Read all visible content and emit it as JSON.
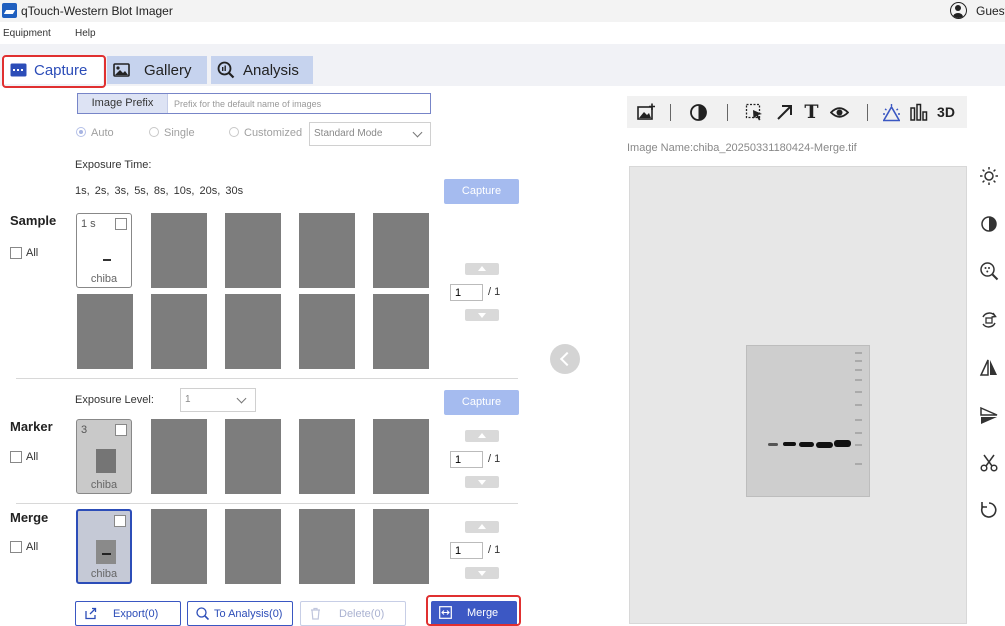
{
  "window": {
    "title": "qTouch-Western Blot Imager",
    "user": "Guest"
  },
  "menu": {
    "items": [
      "Equipment",
      "Help"
    ]
  },
  "tabs": [
    {
      "label": "Capture",
      "active": true
    },
    {
      "label": "Gallery",
      "active": false
    },
    {
      "label": "Analysis",
      "active": false
    }
  ],
  "prefix": {
    "label": "Image Prefix",
    "placeholder": "Prefix for the default name of images"
  },
  "mode": {
    "options": [
      "Auto",
      "Single",
      "Customized"
    ],
    "selected": "Auto",
    "dropdown": "Standard Mode"
  },
  "exposure": {
    "time_label": "Exposure Time:",
    "times": "1s,  2s,  3s,  5s,  8s,  10s,  20s,  30s",
    "level_label": "Exposure Level:",
    "level_value": "1"
  },
  "capture_label": "Capture",
  "all_label": "All",
  "sample": {
    "title": "Sample",
    "thumb_caption": "1 s",
    "thumb_name": "chiba",
    "page": "1",
    "total": "/ 1"
  },
  "marker": {
    "title": "Marker",
    "thumb_caption": "3",
    "thumb_name": "chiba",
    "page": "1",
    "total": "/ 1"
  },
  "merge_section": {
    "title": "Merge",
    "thumb_name": "chiba",
    "page": "1",
    "total": "/ 1"
  },
  "actions": {
    "export": "Export(0)",
    "to_analysis": "To Analysis(0)",
    "delete": "Delete(0)",
    "merge": "Merge"
  },
  "viewer": {
    "image_name": "Image Name:chiba_20250331180424-Merge.tif",
    "toolbar_3d": "3D",
    "toolbar_text": "T"
  },
  "colors": {
    "accent": "#2c4db8",
    "highlight": "#e03030",
    "capture_btn": "#a5bbef",
    "merge_btn": "#3c58c4"
  }
}
